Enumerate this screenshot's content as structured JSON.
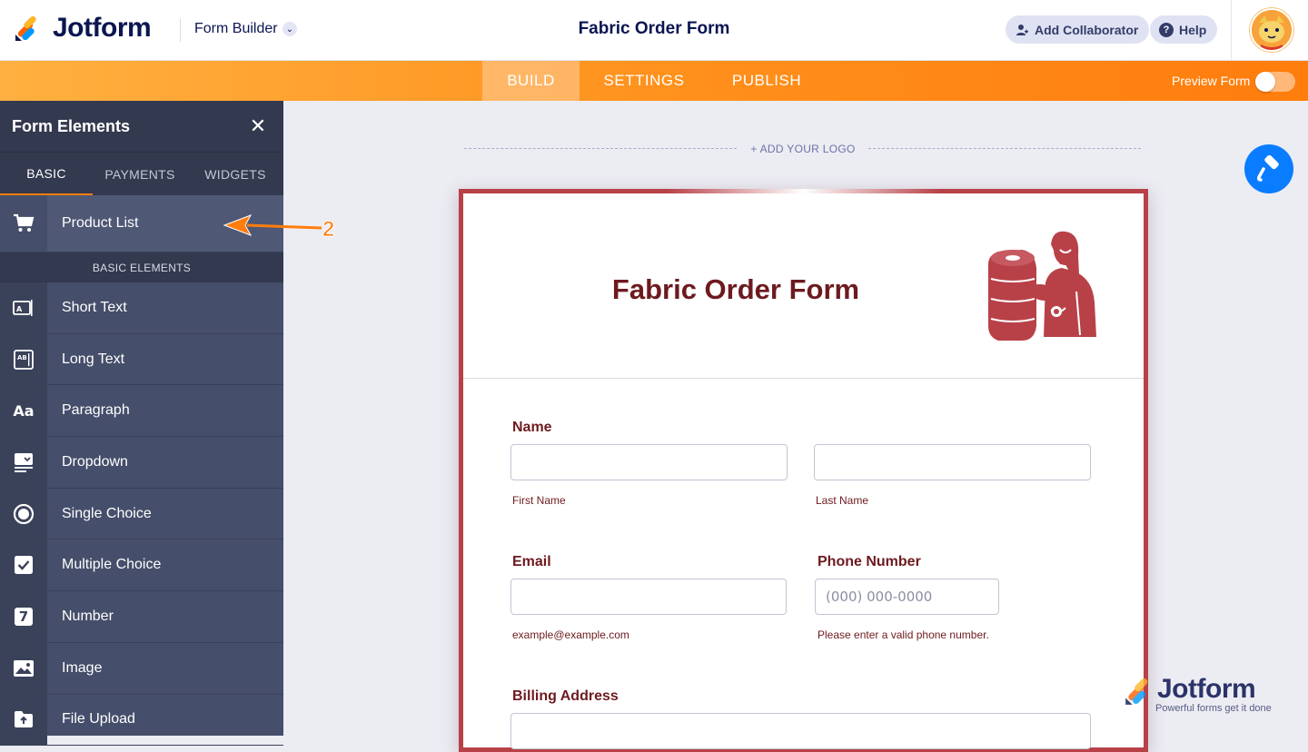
{
  "brand": {
    "name": "Jotform",
    "colors": {
      "accent": "#ff7d0c",
      "navy": "#0a1551",
      "form_border": "#b84148",
      "form_text": "#6d1a1f"
    }
  },
  "header": {
    "builder_label": "Form Builder",
    "form_title": "Fabric Order Form",
    "add_collaborator_label": "Add Collaborator",
    "help_label": "Help"
  },
  "nav": {
    "tabs": [
      {
        "label": "BUILD",
        "active": true
      },
      {
        "label": "SETTINGS",
        "active": false
      },
      {
        "label": "PUBLISH",
        "active": false
      }
    ],
    "preview_label": "Preview Form",
    "preview_enabled": false
  },
  "sidebar": {
    "title": "Form Elements",
    "tabs": [
      {
        "label": "BASIC",
        "active": true
      },
      {
        "label": "PAYMENTS",
        "active": false
      },
      {
        "label": "WIDGETS",
        "active": false
      }
    ],
    "featured": {
      "label": "Product List",
      "icon": "cart-icon"
    },
    "section_label": "BASIC ELEMENTS",
    "items": [
      {
        "label": "Short Text",
        "icon": "short-text-icon"
      },
      {
        "label": "Long Text",
        "icon": "long-text-icon"
      },
      {
        "label": "Paragraph",
        "icon": "paragraph-icon",
        "glyph": "Aa"
      },
      {
        "label": "Dropdown",
        "icon": "dropdown-icon"
      },
      {
        "label": "Single Choice",
        "icon": "radio-icon"
      },
      {
        "label": "Multiple Choice",
        "icon": "checkbox-icon"
      },
      {
        "label": "Number",
        "icon": "number-icon",
        "glyph": "7"
      },
      {
        "label": "Image",
        "icon": "image-icon"
      },
      {
        "label": "File Upload",
        "icon": "file-upload-icon"
      }
    ]
  },
  "annotation": {
    "step": "2"
  },
  "canvas": {
    "add_logo_label": "+ ADD YOUR LOGO",
    "form": {
      "title": "Fabric Order Form",
      "fields": {
        "name": {
          "label": "Name",
          "first_sub": "First Name",
          "last_sub": "Last Name"
        },
        "email": {
          "label": "Email",
          "sub": "example@example.com"
        },
        "phone": {
          "label": "Phone Number",
          "placeholder": "(000) 000-0000",
          "sub": "Please enter a valid phone number."
        },
        "billing": {
          "label": "Billing Address"
        }
      }
    }
  },
  "watermark": {
    "name": "Jotform",
    "tagline": "Powerful forms get it done"
  }
}
